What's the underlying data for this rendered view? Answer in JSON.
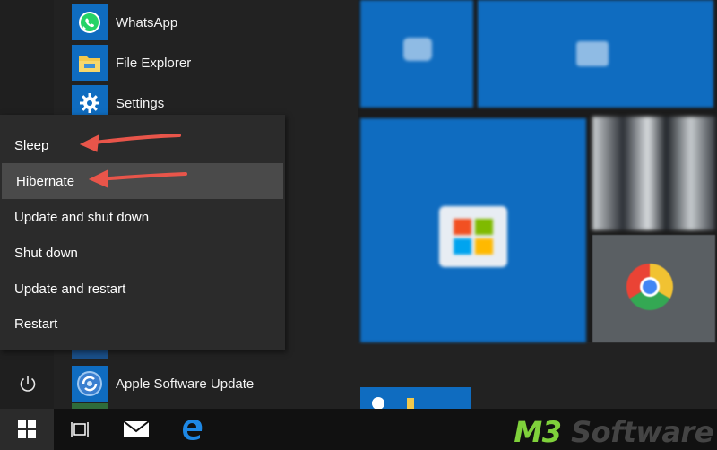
{
  "apps": [
    {
      "label": "WhatsApp",
      "icon": "whatsapp-icon"
    },
    {
      "label": "File Explorer",
      "icon": "folder-icon"
    },
    {
      "label": "Settings",
      "icon": "gear-icon"
    }
  ],
  "bottom_app": {
    "label": "Apple Software Update",
    "icon": "apple-update-icon"
  },
  "power_menu": {
    "items": [
      "Sleep",
      "Hibernate",
      "Update and shut down",
      "Shut down",
      "Update and restart",
      "Restart"
    ],
    "highlighted": "Hibernate"
  },
  "annotation_arrows": {
    "color": "#e8554a",
    "targets": [
      "Sleep",
      "Hibernate"
    ]
  },
  "taskbar": {
    "icons": [
      "windows-start-icon",
      "task-view-icon",
      "mail-icon",
      "edge-icon"
    ]
  },
  "watermark": {
    "part1": "M3",
    "part2": " Software"
  },
  "colors": {
    "accent": "#0f6cc0",
    "menu_bg": "#2b2b2b",
    "menu_highlight": "#4a4a4a"
  }
}
